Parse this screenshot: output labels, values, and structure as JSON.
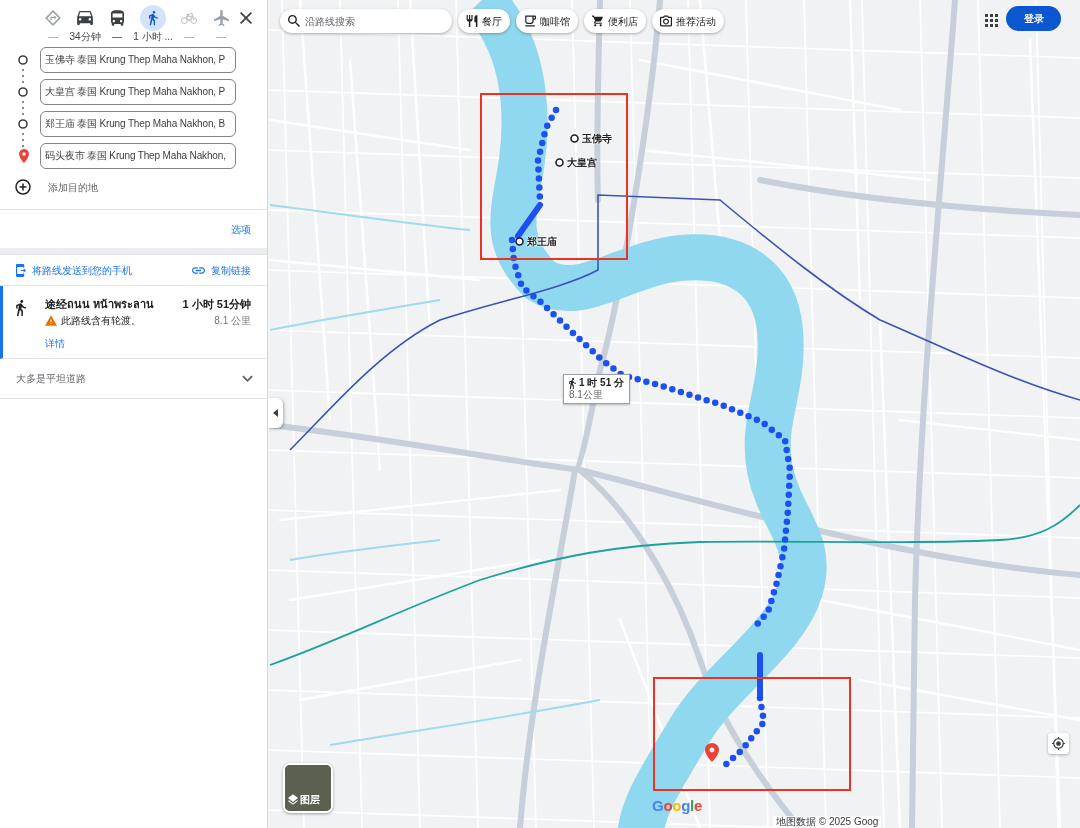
{
  "travel_modes": [
    {
      "kind": "best",
      "label": "—",
      "selected": false,
      "disabled": true
    },
    {
      "kind": "car",
      "label": "34分钟",
      "selected": false,
      "disabled": false
    },
    {
      "kind": "transit",
      "label": "—",
      "selected": false,
      "disabled": false
    },
    {
      "kind": "walk",
      "label": "1 小时 ...",
      "selected": true,
      "disabled": false
    },
    {
      "kind": "bike",
      "label": "—",
      "selected": false,
      "disabled": true
    },
    {
      "kind": "flight",
      "label": "—",
      "selected": false,
      "disabled": true
    }
  ],
  "waypoints": [
    {
      "kind": "stop",
      "value": "玉佛寺 泰国 Krung Thep Maha Nakhon, P"
    },
    {
      "kind": "stop",
      "value": "大皇宫 泰国 Krung Thep Maha Nakhon, P"
    },
    {
      "kind": "stop",
      "value": "郑王庙 泰国 Krung Thep Maha Nakhon, B"
    },
    {
      "kind": "destination",
      "value": "码头夜市 泰国 Krung Thep Maha Nakhon,"
    }
  ],
  "add_destination": {
    "label": "添加目的地"
  },
  "options_link": "选项",
  "share": {
    "send_to_phone": "将路线发送到您的手机",
    "copy_link": "复制链接"
  },
  "route": {
    "selected": true,
    "title": "途经ถนน หน้าพระลาน",
    "warning": "此路线含有轮渡。",
    "duration": "1 小时 51分钟",
    "distance": "8.1 公里",
    "details_link": "详情"
  },
  "route_note": {
    "label": "大多是平坦道路",
    "expanded": false
  },
  "map": {
    "search": {
      "placeholder": "沿路线搜索"
    },
    "chips": [
      {
        "kind": "restaurant",
        "label": "餐厅"
      },
      {
        "kind": "cafe",
        "label": "咖啡馆"
      },
      {
        "kind": "store",
        "label": "便利店"
      },
      {
        "kind": "attraction",
        "label": "推荐活动"
      }
    ],
    "sign_in": "登录",
    "waypoint_labels": [
      "玉佛寺",
      "大皇宫",
      "郑王庙"
    ],
    "route_label": {
      "duration": "1 时 51 分",
      "distance": "8.1公里"
    },
    "layers": "图层",
    "logo": "Google",
    "attribution": "地图数据 © 2025 Goog"
  }
}
